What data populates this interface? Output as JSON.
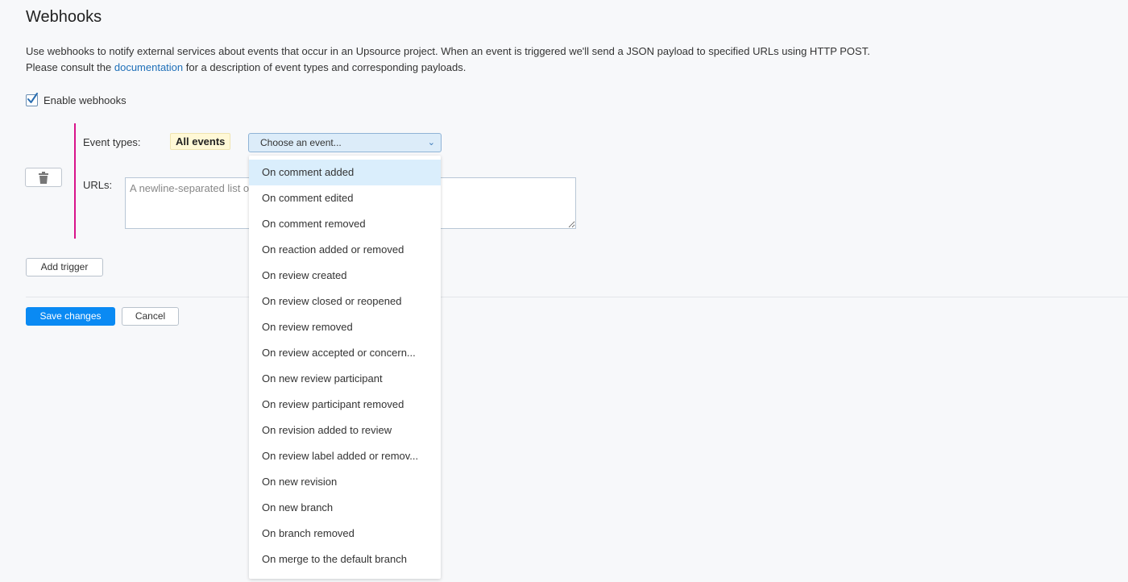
{
  "page": {
    "title": "Webhooks",
    "description_line1": "Use webhooks to notify external services about events that occur in an Upsource project. When an event is triggered we'll send a JSON payload to specified URLs using HTTP POST.",
    "description_line2_before": "Please consult the ",
    "description_link": "documentation",
    "description_line2_after": " for a description of event types and corresponding payloads."
  },
  "enable": {
    "label": "Enable webhooks",
    "checked": true
  },
  "trigger": {
    "event_types_label": "Event types:",
    "all_events_badge": "All events",
    "select_value": "Choose an event...",
    "urls_label": "URLs:",
    "urls_placeholder": "A newline-separated list of URLs",
    "urls_value": "",
    "accent_color": "#d8138a"
  },
  "buttons": {
    "add_trigger": "Add trigger",
    "save": "Save changes",
    "cancel": "Cancel"
  },
  "dropdown": {
    "highlighted_index": 0,
    "options": [
      "On comment added",
      "On comment edited",
      "On comment removed",
      "On reaction added or removed",
      "On review created",
      "On review closed or reopened",
      "On review removed",
      "On review accepted or concern...",
      "On new review participant",
      "On review participant removed",
      "On revision added to review",
      "On review label added or remov...",
      "On new revision",
      "On new branch",
      "On branch removed",
      "On merge to the default branch"
    ]
  },
  "colors": {
    "primary": "#0a8af3",
    "link": "#1e6fb8",
    "badge_bg": "#fff8d6",
    "highlight": "#daeefc"
  }
}
